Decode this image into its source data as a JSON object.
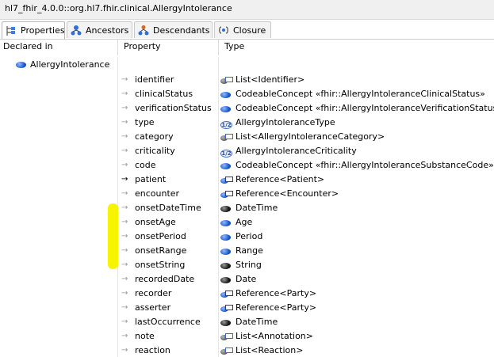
{
  "window": {
    "title": "hl7_fhir_4.0.0::org.hl7.fhir.clinical.AllergyIntolerance"
  },
  "tabs": [
    {
      "label": "Properties",
      "icon": "properties-icon",
      "active": true
    },
    {
      "label": "Ancestors",
      "icon": "ancestors-icon",
      "active": false
    },
    {
      "label": "Descendants",
      "icon": "descendants-icon",
      "active": false
    },
    {
      "label": "Closure",
      "icon": "closure-icon",
      "active": false
    }
  ],
  "columns": {
    "declared_in": "Declared in",
    "property": "Property",
    "type": "Type"
  },
  "declared_in": {
    "name": "AllergyIntolerance",
    "icon": "class-icon"
  },
  "rows": [
    {
      "property": "identifier",
      "type": "List<Identifier>",
      "type_icon": "list-icon",
      "arrow": "list"
    },
    {
      "property": "clinicalStatus",
      "type": "CodeableConcept «fhir::AllergyIntoleranceClinicalStatus»",
      "type_icon": "class-icon",
      "arrow": "plain"
    },
    {
      "property": "verificationStatus",
      "type": "CodeableConcept «fhir::AllergyIntoleranceVerificationStatus»",
      "type_icon": "class-icon",
      "arrow": "plain"
    },
    {
      "property": "type",
      "type": "AllergyIntoleranceType",
      "type_icon": "enum-icon",
      "arrow": "plain"
    },
    {
      "property": "category",
      "type": "List<AllergyIntoleranceCategory>",
      "type_icon": "list-icon",
      "arrow": "list"
    },
    {
      "property": "criticality",
      "type": "AllergyIntoleranceCriticality",
      "type_icon": "enum-icon",
      "arrow": "plain"
    },
    {
      "property": "code",
      "type": "CodeableConcept «fhir::AllergyIntoleranceSubstanceCode»",
      "type_icon": "class-icon",
      "arrow": "plain"
    },
    {
      "property": "patient",
      "type": "Reference<Patient>",
      "type_icon": "reference-icon",
      "arrow": "dark"
    },
    {
      "property": "encounter",
      "type": "Reference<Encounter>",
      "type_icon": "reference-icon",
      "arrow": "plain"
    },
    {
      "property": "onsetDateTime",
      "type": "DateTime",
      "type_icon": "primitive-icon",
      "arrow": "plain"
    },
    {
      "property": "onsetAge",
      "type": "Age",
      "type_icon": "class-icon",
      "arrow": "plain"
    },
    {
      "property": "onsetPeriod",
      "type": "Period",
      "type_icon": "class-icon",
      "arrow": "plain"
    },
    {
      "property": "onsetRange",
      "type": "Range",
      "type_icon": "class-icon",
      "arrow": "plain"
    },
    {
      "property": "onsetString",
      "type": "String",
      "type_icon": "primitive-icon",
      "arrow": "plain"
    },
    {
      "property": "recordedDate",
      "type": "Date",
      "type_icon": "primitive-icon",
      "arrow": "plain"
    },
    {
      "property": "recorder",
      "type": "Reference<Party>",
      "type_icon": "reference-icon",
      "arrow": "plain"
    },
    {
      "property": "asserter",
      "type": "Reference<Party>",
      "type_icon": "reference-icon",
      "arrow": "plain"
    },
    {
      "property": "lastOccurrence",
      "type": "DateTime",
      "type_icon": "primitive-icon",
      "arrow": "plain"
    },
    {
      "property": "note",
      "type": "List<Annotation>",
      "type_icon": "list-icon",
      "arrow": "list"
    },
    {
      "property": "reaction",
      "type": "List<Reaction>",
      "type_icon": "list-icon",
      "arrow": "list"
    }
  ],
  "colors": {
    "highlight": "#f7f400",
    "class_blue": "#1655c9"
  }
}
